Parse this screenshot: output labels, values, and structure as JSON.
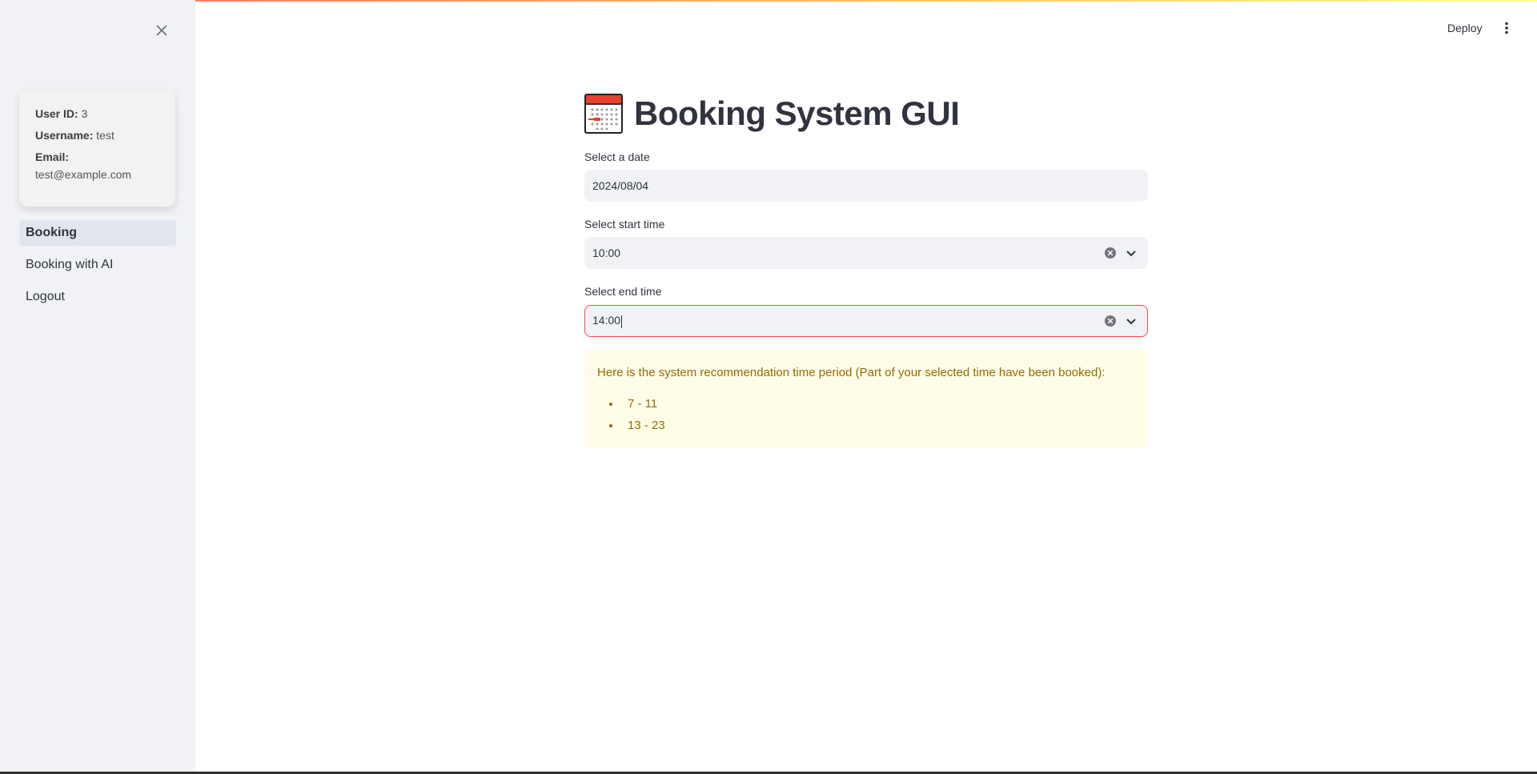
{
  "sidebar": {
    "user": {
      "user_id_label": "User ID:",
      "user_id_value": "3",
      "username_label": "Username:",
      "username_value": "test",
      "email_label": "Email:",
      "email_value": "test@example.com"
    },
    "nav": [
      {
        "label": "Booking",
        "active": true
      },
      {
        "label": "Booking with AI",
        "active": false
      },
      {
        "label": "Logout",
        "active": false
      }
    ]
  },
  "header": {
    "deploy_label": "Deploy"
  },
  "main": {
    "title": "Booking System GUI",
    "date_field": {
      "label": "Select a date",
      "value": "2024/08/04"
    },
    "start_time_field": {
      "label": "Select start time",
      "value": "10:00"
    },
    "end_time_field": {
      "label": "Select end time",
      "value": "14:00"
    },
    "recommendation": {
      "message": "Here is the system recommendation time period (Part of your selected time have been booked):",
      "items": [
        "7 - 11",
        "13 - 23"
      ]
    }
  },
  "colors": {
    "accent": "#ff4b4b",
    "sidebar_bg": "#f0f2f6",
    "warning_bg": "#fffce7",
    "warning_text": "#926c05"
  }
}
